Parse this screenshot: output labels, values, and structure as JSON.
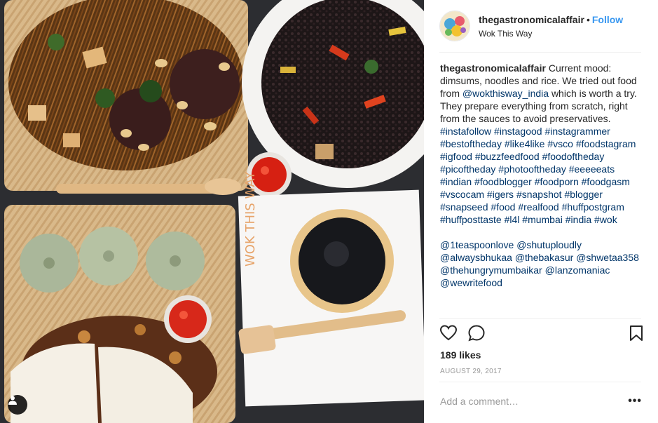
{
  "post": {
    "username": "thegastronomicalaffair",
    "separator": "•",
    "follow_label": "Follow",
    "location": "Wok This Way",
    "caption_intro": "Current mood: dimsums, noodles and rice. We tried out food from",
    "caption_mention": "@wokthisway_india",
    "caption_rest": "which is worth a try. They prepare everything from scratch, right from the sauces to avoid preservatives.",
    "hashtags": [
      "#instafollow",
      "#instagood",
      "#instagrammer",
      "#bestoftheday",
      "#like4like",
      "#vsco",
      "#foodstagram",
      "#igfood",
      "#buzzfeedfood",
      "#foodoftheday",
      "#picoftheday",
      "#photooftheday",
      "#eeeeeats",
      "#indian",
      "#foodblogger",
      "#foodporn",
      "#foodgasm",
      "#vscocam",
      "#igers",
      "#snapshot",
      "#blogger",
      "#snapseed",
      "#food",
      "#realfood",
      "#huffpostgram",
      "#huffposttaste",
      "#l4l",
      "#mumbai",
      "#india",
      "#wok"
    ],
    "mentions": [
      "@1teaspoonlove",
      "@shutuploudly",
      "@alwaysbhukaa",
      "@thebakasur",
      "@shwetaa358",
      "@thehungrymumbaikar",
      "@lanzomaniac",
      "@wewritefood"
    ],
    "likes": "189 likes",
    "date": "AUGUST 29, 2017",
    "comment_placeholder": "Add a comment…",
    "more_label": "•••"
  },
  "icons": {
    "like": "heart-icon",
    "comment": "comment-icon",
    "save": "bookmark-icon",
    "tag": "user-tag-icon",
    "more": "more-options-icon"
  },
  "colors": {
    "follow": "#3897f0",
    "link": "#003569",
    "muted": "#999999"
  }
}
